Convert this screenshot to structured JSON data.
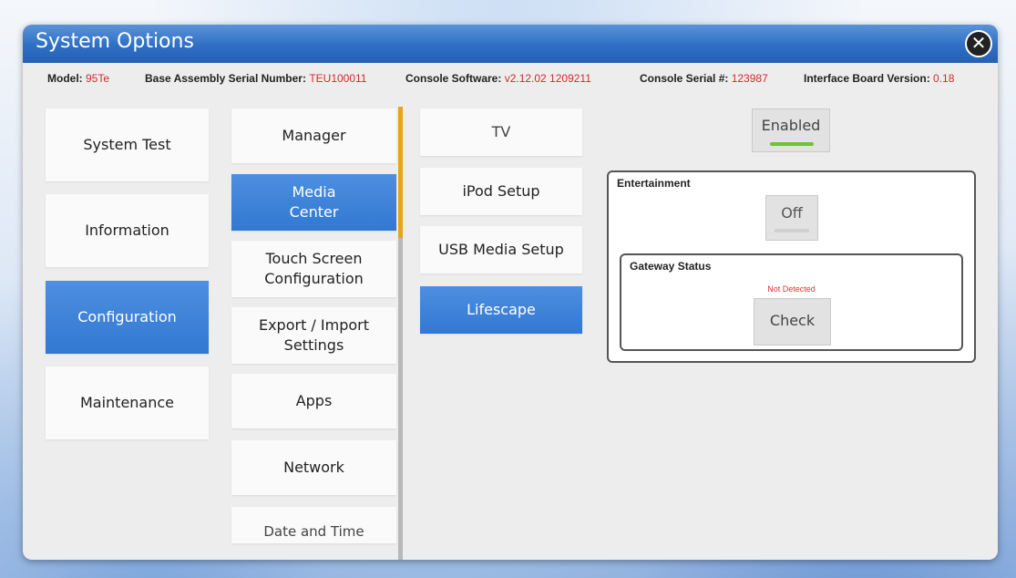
{
  "window": {
    "title": "System Options",
    "close_icon": "close-icon"
  },
  "info": {
    "model_label": "Model: ",
    "model_value": "95Te",
    "serial_label": "Base Assembly Serial Number: ",
    "serial_value": "TEU100011",
    "software_label": "Console Software: ",
    "software_value": "v2.12.02 1209211",
    "console_serial_label": "Console Serial #: ",
    "console_serial_value": "123987",
    "interface_label": "Interface Board Version: ",
    "interface_value": "0.18",
    "value_color": "#d42a2a"
  },
  "col1": [
    "System Test",
    "Information",
    "Configuration",
    "Maintenance"
  ],
  "col2": [
    "Manager",
    "Media\nCenter",
    "Touch Screen\nConfiguration",
    "Export / Import\nSettings",
    "Apps",
    "Network",
    "Date and Time"
  ],
  "col3": [
    "TV",
    "iPod Setup",
    "USB Media Setup",
    "Lifescape"
  ],
  "lifescape": {
    "enabled_label": "Enabled",
    "entertainment_title": "Entertainment",
    "off_label": "Off",
    "gateway_title": "Gateway Status",
    "gateway_status": "Not Detected",
    "check_label": "Check"
  },
  "colors": {
    "accent": "#3278d2",
    "scroll_thumb": "#e8a318",
    "enabled_indicator": "#6fc23a"
  }
}
